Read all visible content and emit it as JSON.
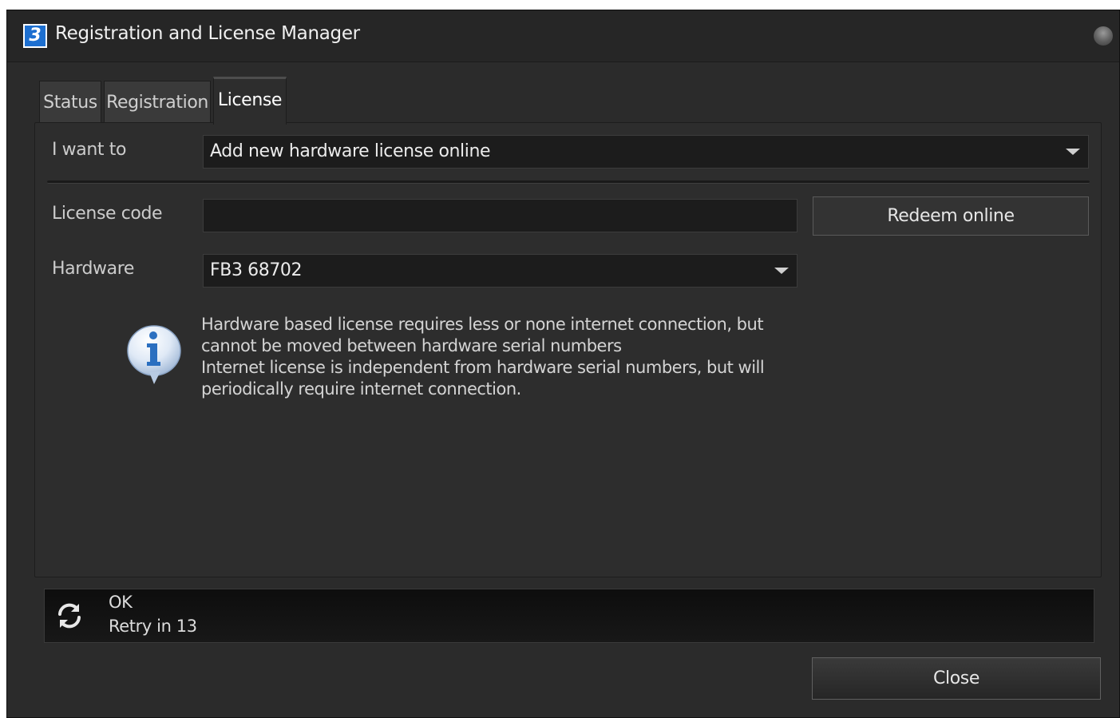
{
  "window": {
    "title": "Registration and License Manager",
    "app_icon_glyph": "3"
  },
  "tabs": [
    {
      "label": "Status",
      "active": false
    },
    {
      "label": "Registration",
      "active": false
    },
    {
      "label": "License",
      "active": true
    }
  ],
  "form": {
    "i_want_to_label": "I want to",
    "i_want_to_value": "Add new hardware license online",
    "license_code_label": "License code",
    "license_code_value": "",
    "redeem_button": "Redeem online",
    "hardware_label": "Hardware",
    "hardware_value": "FB3 68702"
  },
  "info": {
    "icon": "info-bubble-icon",
    "lines": [
      "Hardware based license requires less or none internet connection, but",
      "cannot be moved between hardware serial numbers",
      "Internet license is independent from hardware serial numbers, but will",
      "periodically require internet connection."
    ]
  },
  "status": {
    "icon": "refresh-icon",
    "line1": "OK",
    "line2": "Retry in 13"
  },
  "footer": {
    "close_button": "Close"
  },
  "colors": {
    "window_bg": "#2b2b2b",
    "field_bg": "#1c1c1c",
    "app_icon_blue": "#1d6fd0",
    "info_blue": "#2b6fc0"
  }
}
